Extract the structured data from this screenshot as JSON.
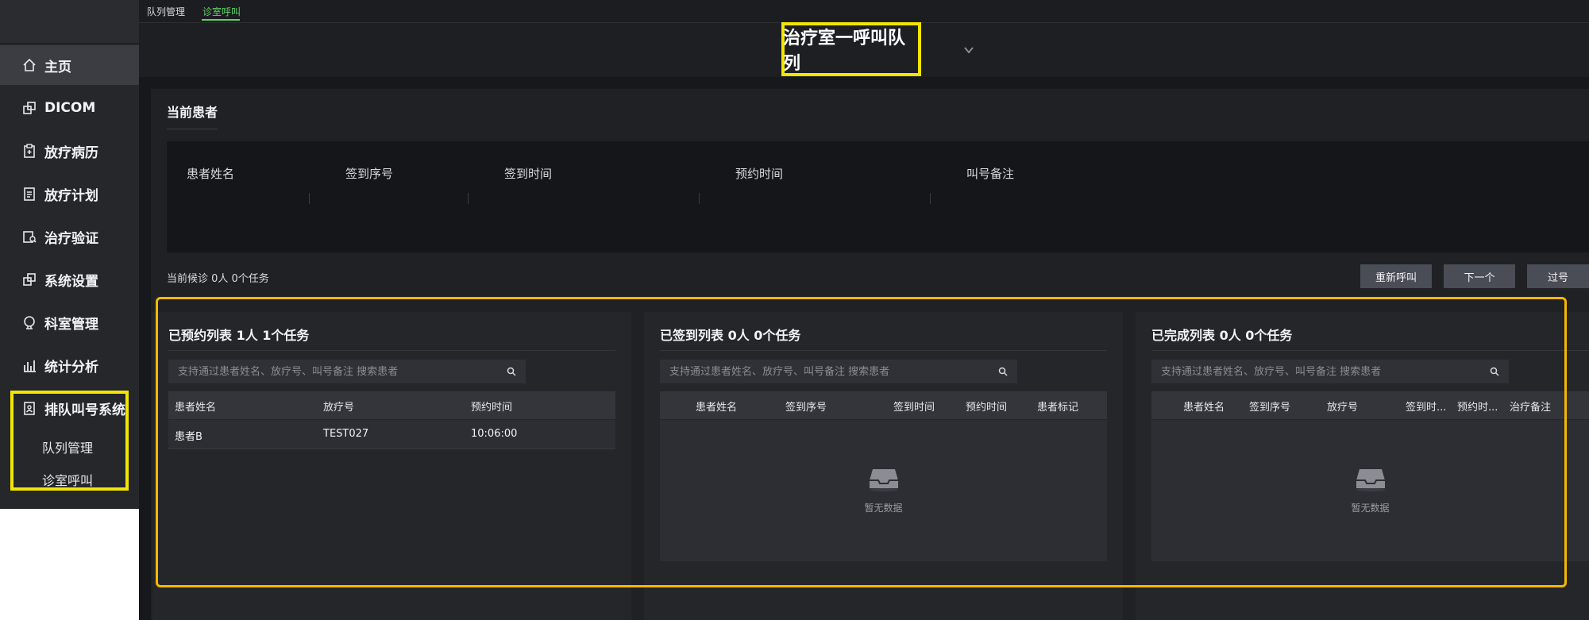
{
  "sidebar": {
    "items": [
      {
        "label": "主页",
        "icon": "home-icon"
      },
      {
        "label": "DICOM",
        "icon": "dicom-icon"
      },
      {
        "label": "放疗病历",
        "icon": "clipboard-icon"
      },
      {
        "label": "放疗计划",
        "icon": "document-icon"
      },
      {
        "label": "治疗验证",
        "icon": "verify-icon"
      },
      {
        "label": "系统设置",
        "icon": "settings-icon"
      },
      {
        "label": "科室管理",
        "icon": "department-icon"
      },
      {
        "label": "统计分析",
        "icon": "chart-icon"
      },
      {
        "label": "排队叫号系统",
        "icon": "queue-icon"
      }
    ],
    "sub_items": [
      "队列管理",
      "诊室呼叫"
    ]
  },
  "tabs": [
    "队列管理",
    "诊室呼叫"
  ],
  "header": {
    "title": "治疗室一呼叫队列"
  },
  "current": {
    "title": "当前患者",
    "columns": [
      "患者姓名",
      "签到序号",
      "签到时间",
      "预约时间",
      "叫号备注"
    ],
    "waiting_text": "当前候诊 0人 0个任务",
    "buttons": [
      "重新呼叫",
      "下一个",
      "过号"
    ]
  },
  "panels": [
    {
      "title": "已预约列表 1人 1个任务",
      "search_placeholder": "支持通过患者姓名、放疗号、叫号备注 搜索患者",
      "columns": [
        "患者姓名",
        "放疗号",
        "预约时间"
      ],
      "rows": [
        [
          "患者B",
          "TEST027",
          "10:06:00"
        ]
      ]
    },
    {
      "title": "已签到列表 0人 0个任务",
      "search_placeholder": "支持通过患者姓名、放疗号、叫号备注 搜索患者",
      "columns": [
        "患者姓名",
        "签到序号",
        "签到时间",
        "预约时间",
        "患者标记"
      ],
      "empty_text": "暂无数据"
    },
    {
      "title": "已完成列表 0人 0个任务",
      "search_placeholder": "支持通过患者姓名、放疗号、叫号备注 搜索患者",
      "columns": [
        "患者姓名",
        "签到序号",
        "放疗号",
        "签到时...",
        "预约时...",
        "治疗备注"
      ],
      "empty_text": "暂无数据"
    }
  ],
  "colors": {
    "accent_green": "#5fd16a",
    "highlight_yellow": "#f2e600",
    "highlight_orange": "#f5b800"
  }
}
